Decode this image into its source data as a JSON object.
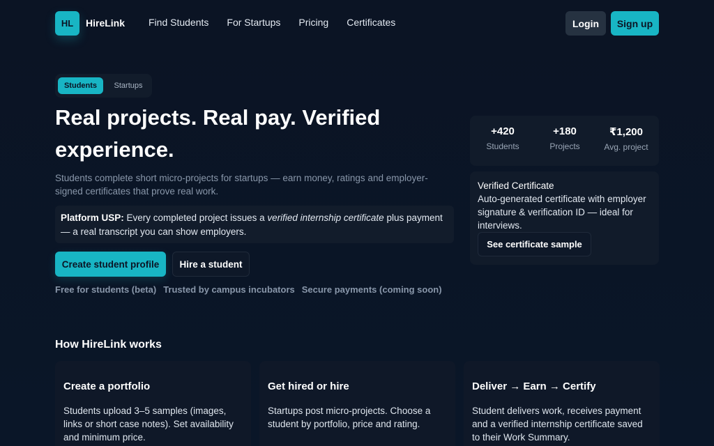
{
  "header": {
    "logo_initials": "HL",
    "brand": "HireLink",
    "nav": [
      "Find Students",
      "For Startups",
      "Pricing",
      "Certificates"
    ],
    "login_label": "Login",
    "signup_label": "Sign up"
  },
  "toggle": {
    "active": "Students",
    "inactive": "Startups"
  },
  "hero": {
    "title": "Real projects. Real pay. Verified experience.",
    "subtitle": "Students complete short micro-projects for startups — earn money, ratings and employer-signed certificates that prove real work.",
    "usp_label": "Platform USP:",
    "usp_text_1": " Every completed project issues a ",
    "usp_italic": "verified internship certificate",
    "usp_text_2": " plus payment — a real transcript you can show employers.",
    "cta_primary": "Create student profile",
    "cta_secondary": "Hire a student",
    "trust": [
      "Free for students (beta)",
      "Trusted by campus incubators",
      "Secure payments (coming soon)"
    ]
  },
  "stats": [
    {
      "value": "+420",
      "label": "Students"
    },
    {
      "value": "+180",
      "label": "Projects"
    },
    {
      "value": "₹1,200",
      "label": "Avg. project"
    }
  ],
  "certificate": {
    "title": "Verified Certificate",
    "description": "Auto-generated certificate with employer signature & verification ID — ideal for interviews.",
    "button": "See certificate sample"
  },
  "how": {
    "title": "How HireLink works",
    "steps": [
      {
        "title": "Create a portfolio",
        "desc": "Students upload 3–5 samples (images, links or short case notes). Set availability and minimum price."
      },
      {
        "title": "Get hired or hire",
        "desc": "Startups post micro-projects. Choose a student by portfolio, price and rating."
      },
      {
        "title": "Deliver → Earn → Certify",
        "desc": "Student delivers work, receives payment and a verified internship certificate saved to their Work Summary."
      }
    ]
  },
  "colors": {
    "accent": "#18b5c4",
    "background": "#0b1424",
    "card": "#111b2a"
  }
}
